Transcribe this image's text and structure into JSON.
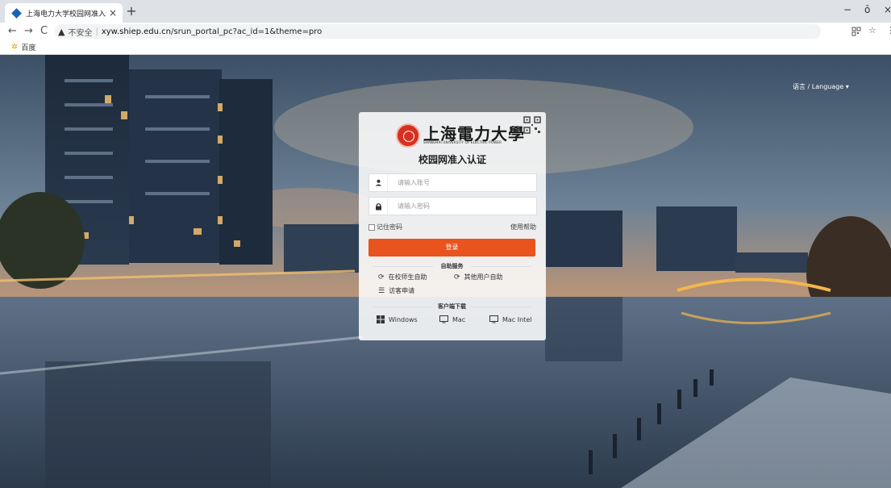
{
  "browser": {
    "tab_title": "上海电力大学校园网准入认证",
    "tab_close": "×",
    "new_tab": "+",
    "nav_back": "←",
    "nav_forward": "→",
    "nav_reload": "C",
    "security_warning": "▲",
    "insecure_label": "不安全",
    "separator": "|",
    "url_domain": "xyw.shiep.edu.cn",
    "url_path": "/srun_portal_pc?ac_id=1&theme=pro",
    "win_minimize": "−",
    "win_maximize": "ō",
    "win_close": "×",
    "bookmark": "百度"
  },
  "page": {
    "language": "语言 / Language ▾"
  },
  "login": {
    "brand_cn": "上海電力大學",
    "brand_en": "SHANGHAI UNIVERSITY OF ELECTRIC POWER",
    "title": "校园网准入认证",
    "username_placeholder": "请输入账号",
    "password_placeholder": "请输入密码",
    "remember_label": "记住密码",
    "help_label": "使用帮助",
    "login_button": "登录",
    "self_service_heading": "自助服务",
    "self_service_items": [
      "在校师生自助",
      "其他用户自助",
      "访客申请"
    ],
    "download_heading": "客户端下载",
    "downloads": [
      "Windows",
      "Mac",
      "Mac Intel"
    ]
  },
  "colors": {
    "accent": "#e8531e",
    "tab_favicon": "#1a63b8"
  }
}
